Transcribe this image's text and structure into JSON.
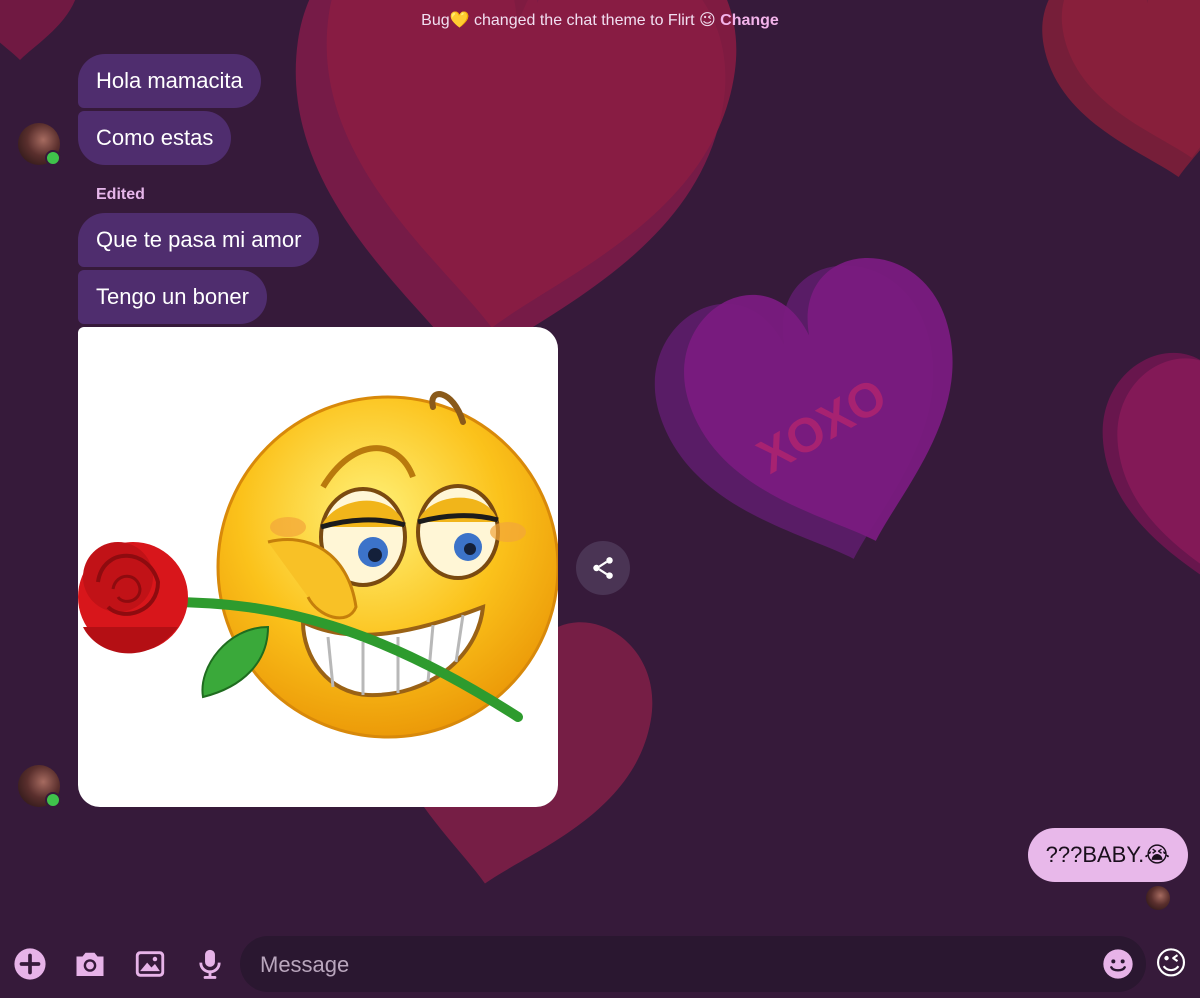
{
  "theme_notice": {
    "actor": "Bug💛",
    "text": " changed the chat theme to Flirt 😉 ",
    "action_label": "Change"
  },
  "messages": {
    "m1": "Hola mamacita",
    "m2": "Como estas",
    "edited_label": "Edited",
    "m3": "Que te pasa mi amor",
    "m4": "Tengo un boner",
    "sent": "???BABY.😭"
  },
  "background": {
    "heart_text": "XOXO"
  },
  "composer": {
    "placeholder": "Message",
    "quick_reaction": "😉"
  },
  "colors": {
    "background": "#361a3a",
    "incoming_bubble": "#4f2d6e",
    "outgoing_bubble": "#e8b8ea",
    "accent": "#f3b3ea"
  }
}
